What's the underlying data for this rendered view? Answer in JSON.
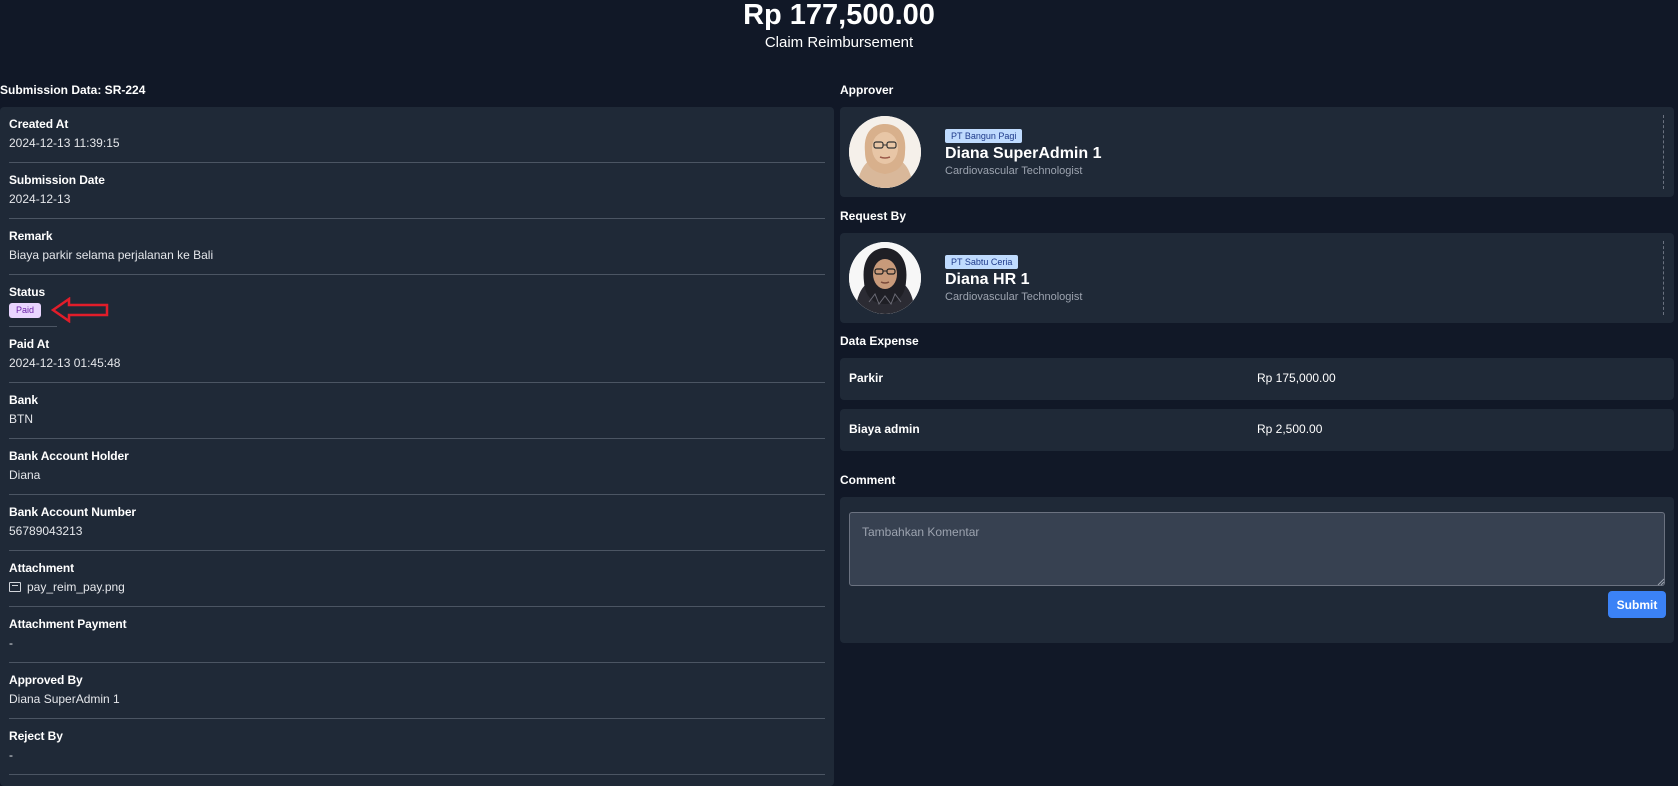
{
  "header": {
    "amount": "Rp 177,500.00",
    "subtitle": "Claim Reimbursement"
  },
  "submission": {
    "title": "Submission Data: SR-224",
    "fields": {
      "created_at": {
        "label": "Created At",
        "value": "2024-12-13 11:39:15"
      },
      "submission_date": {
        "label": "Submission Date",
        "value": "2024-12-13"
      },
      "remark": {
        "label": "Remark",
        "value": "Biaya parkir selama perjalanan ke Bali"
      },
      "status": {
        "label": "Status",
        "value": "Paid",
        "badge_color": "#e9d5ff"
      },
      "paid_at": {
        "label": "Paid At",
        "value": "2024-12-13 01:45:48"
      },
      "bank": {
        "label": "Bank",
        "value": "BTN"
      },
      "account_holder": {
        "label": "Bank Account Holder",
        "value": "Diana"
      },
      "account_number": {
        "label": "Bank Account Number",
        "value": "56789043213"
      },
      "attachment": {
        "label": "Attachment",
        "value": "pay_reim_pay.png",
        "icon": "image-icon"
      },
      "attachment_payment": {
        "label": "Attachment Payment",
        "value": "-"
      },
      "approved_by": {
        "label": "Approved By",
        "value": "Diana SuperAdmin 1"
      },
      "reject_by": {
        "label": "Reject By",
        "value": "-"
      }
    }
  },
  "approver": {
    "section_title": "Approver",
    "company": "PT Bangun Pagi",
    "name": "Diana SuperAdmin 1",
    "role": "Cardiovascular Technologist"
  },
  "requester": {
    "section_title": "Request By",
    "company": "PT Sabtu Ceria",
    "name": "Diana HR 1",
    "role": "Cardiovascular Technologist"
  },
  "expenses": {
    "section_title": "Data Expense",
    "items": [
      {
        "name": "Parkir",
        "amount": "Rp 175,000.00"
      },
      {
        "name": "Biaya admin",
        "amount": "Rp 2,500.00"
      }
    ]
  },
  "comment": {
    "section_title": "Comment",
    "placeholder": "Tambahkan Komentar",
    "submit_label": "Submit"
  },
  "colors": {
    "background": "#111827",
    "panel": "#1f2937",
    "accent": "#3b82f6",
    "annotation_arrow": "#e11d2a"
  }
}
